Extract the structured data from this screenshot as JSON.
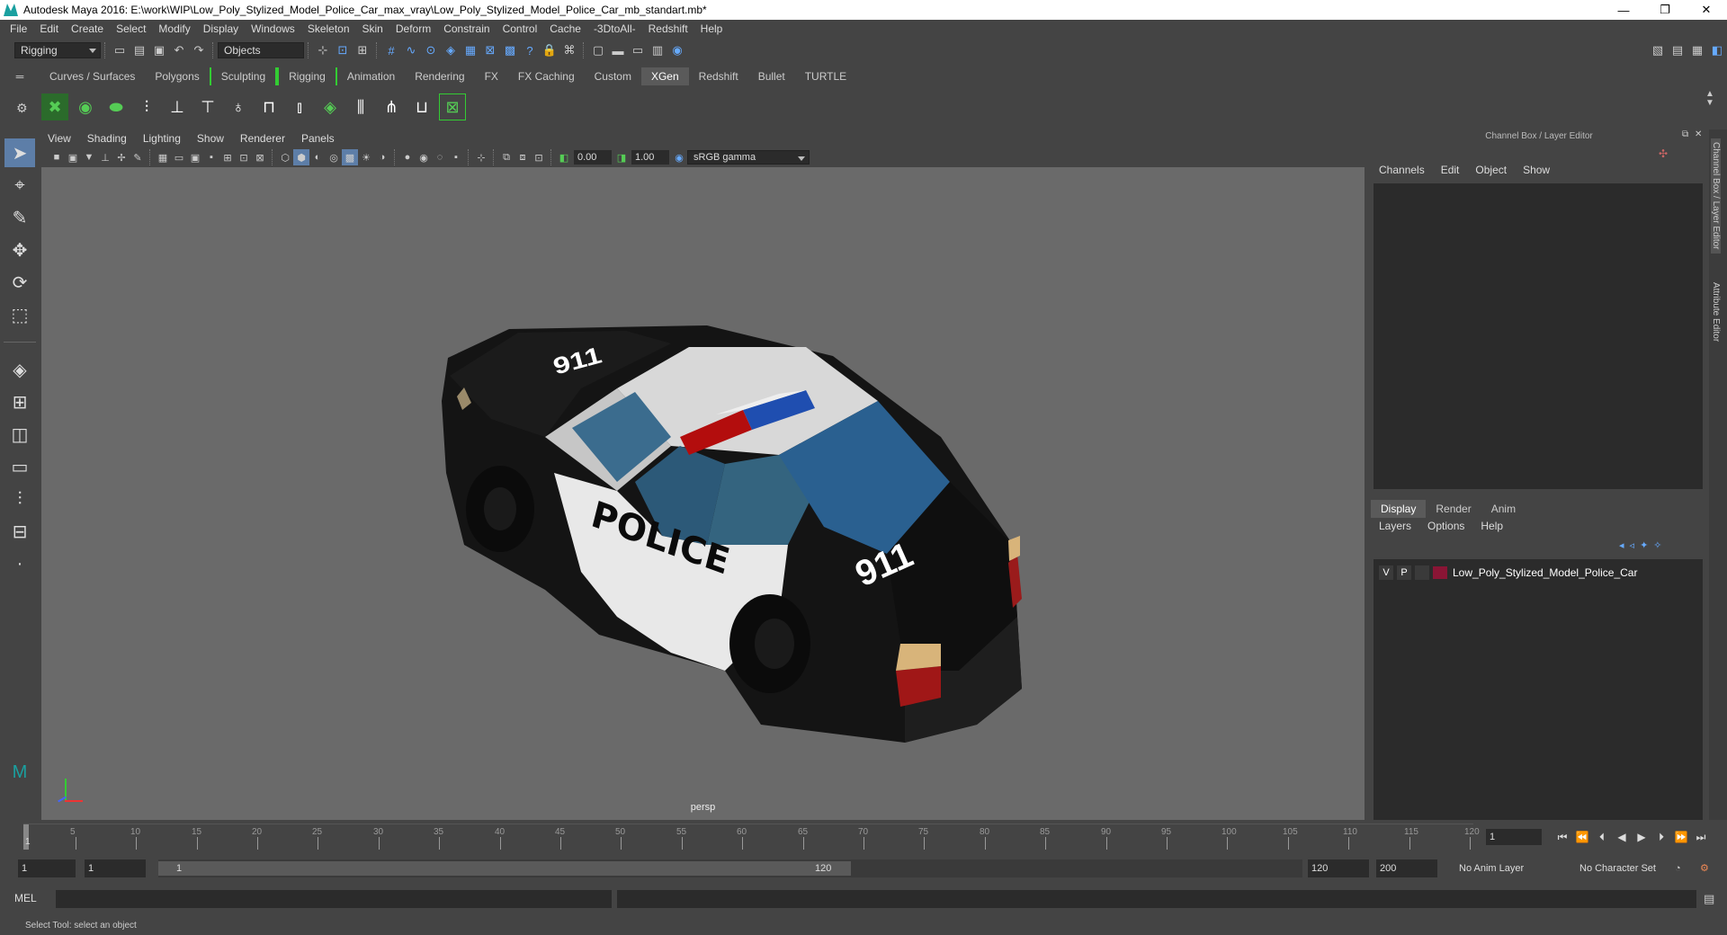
{
  "window": {
    "title": "Autodesk Maya 2016: E:\\work\\WIP\\Low_Poly_Stylized_Model_Police_Car_max_vray\\Low_Poly_Stylized_Model_Police_Car_mb_standart.mb*",
    "minimize": "—",
    "restore": "❐",
    "close": "✕"
  },
  "menubar": [
    "File",
    "Edit",
    "Create",
    "Select",
    "Modify",
    "Display",
    "Windows",
    "Skeleton",
    "Skin",
    "Deform",
    "Constrain",
    "Control",
    "Cache",
    "-3DtoAll-",
    "Redshift",
    "Help"
  ],
  "statusline": {
    "mode": "Rigging",
    "selection_mode": "Objects"
  },
  "shelf_tabs": [
    {
      "label": "Curves / Surfaces",
      "active": false
    },
    {
      "label": "Polygons",
      "active": false
    },
    {
      "label": "Sculpting",
      "active": false
    },
    {
      "label": "Rigging",
      "active": false
    },
    {
      "label": "Animation",
      "active": false
    },
    {
      "label": "Rendering",
      "active": false
    },
    {
      "label": "FX",
      "active": false
    },
    {
      "label": "FX Caching",
      "active": false
    },
    {
      "label": "Custom",
      "active": false
    },
    {
      "label": "XGen",
      "active": true
    },
    {
      "label": "Redshift",
      "active": false
    },
    {
      "label": "Bullet",
      "active": false
    },
    {
      "label": "TURTLE",
      "active": false
    }
  ],
  "viewport": {
    "menu": [
      "View",
      "Shading",
      "Lighting",
      "Show",
      "Renderer",
      "Panels"
    ],
    "exposure": "0.00",
    "gamma": "1.00",
    "color_space": "sRGB gamma",
    "camera": "persp",
    "car_text_side": "POLICE",
    "car_text_roof": "911",
    "car_text_trunk": "911"
  },
  "right_panel": {
    "title": "Channel Box / Layer Editor",
    "menu": [
      "Channels",
      "Edit",
      "Object",
      "Show"
    ],
    "tabs": [
      {
        "label": "Display",
        "active": true
      },
      {
        "label": "Render",
        "active": false
      },
      {
        "label": "Anim",
        "active": false
      }
    ],
    "layer_menu": [
      "Layers",
      "Options",
      "Help"
    ],
    "layer": {
      "visible": "V",
      "playback": "P",
      "name": "Low_Poly_Stylized_Model_Police_Car",
      "color": "#8a1535"
    },
    "side_tab_1": "Channel Box / Layer Editor",
    "side_tab_2": "Attribute Editor"
  },
  "timeline": {
    "ticks": [
      "5",
      "10",
      "15",
      "20",
      "25",
      "30",
      "35",
      "40",
      "45",
      "50",
      "55",
      "60",
      "65",
      "70",
      "75",
      "80",
      "85",
      "90",
      "95",
      "100",
      "105",
      "110",
      "115",
      "120"
    ],
    "current_frame": "1",
    "start_label": "1"
  },
  "range": {
    "start": "1",
    "playback_start": "1",
    "slider_start": "1",
    "slider_end": "120",
    "playback_end": "120",
    "end": "200",
    "anim_layer": "No Anim Layer",
    "character_set": "No Character Set"
  },
  "mel": {
    "label": "MEL"
  },
  "help": {
    "text": "Select Tool: select an object"
  }
}
